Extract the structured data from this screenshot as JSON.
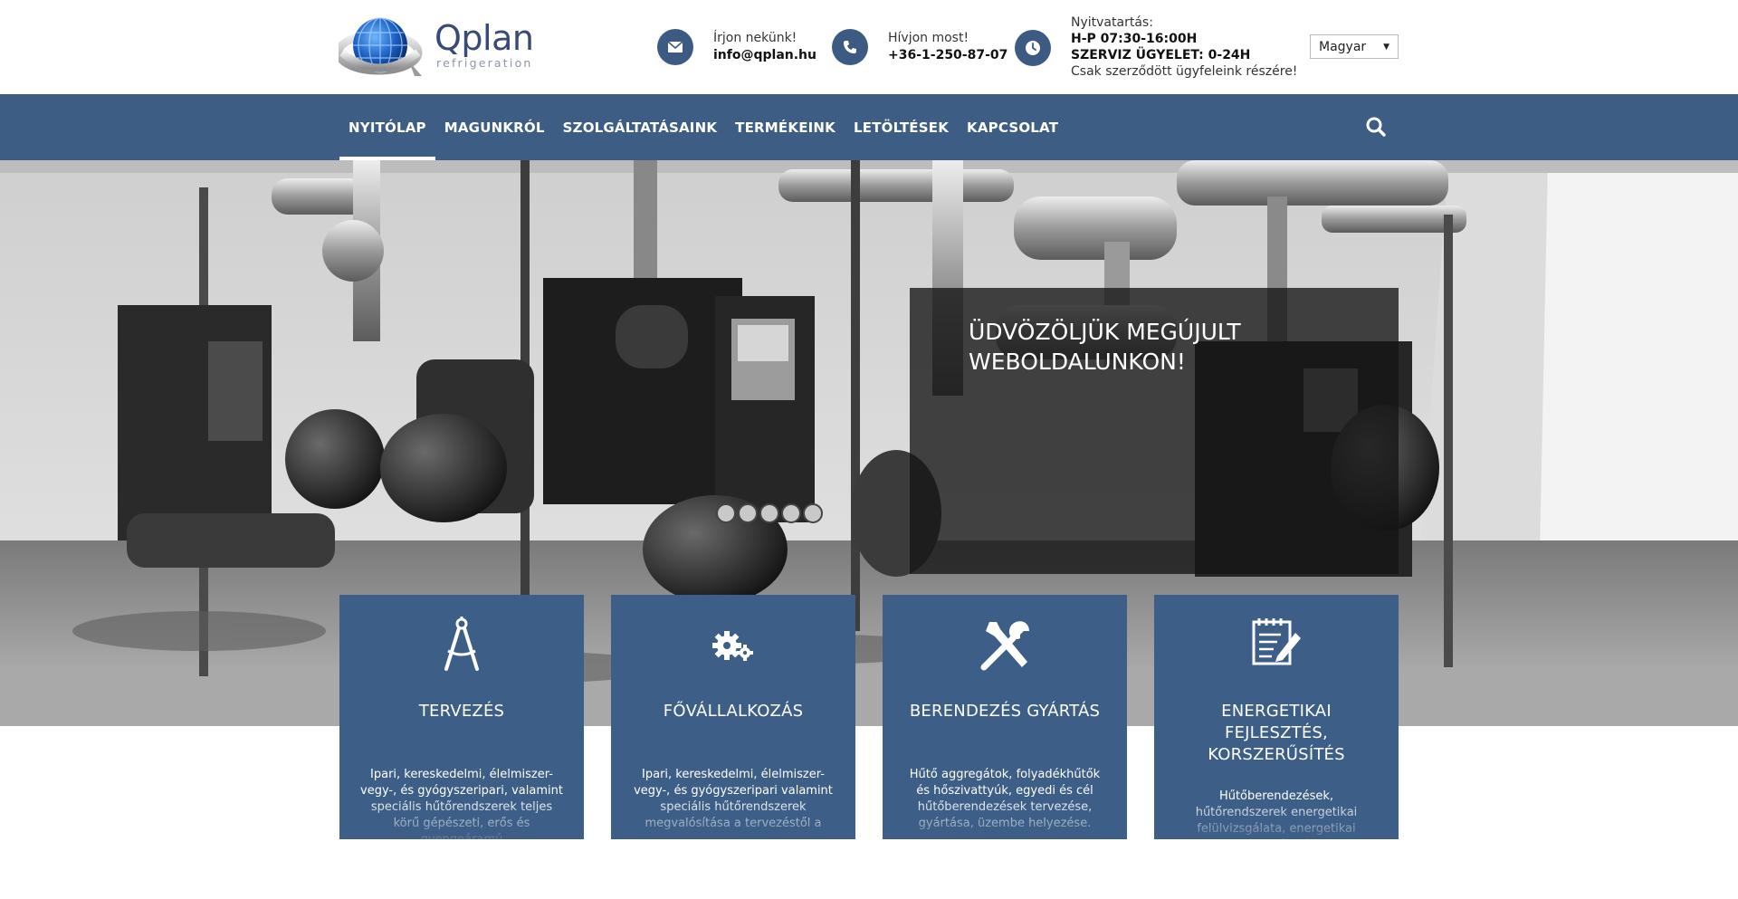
{
  "brand": {
    "name": "Qplan",
    "tagline": "refrigeration",
    "icon": "globe-logo-icon",
    "color": "#3d5d85"
  },
  "contact": {
    "email": {
      "label": "Írjon nekünk!",
      "value": "info@qplan.hu",
      "icon": "envelope-icon"
    },
    "phone": {
      "label": "Hívjon most!",
      "value": "+36-1-250-87-07",
      "icon": "phone-icon"
    },
    "hours": {
      "label": "Nyitvatartás:",
      "line1": "H-P 07:30-16:00H",
      "line2": "SZERVIZ ÜGYELET: 0-24H",
      "note": "Csak szerződött ügyfeleink részére!",
      "icon": "clock-icon"
    }
  },
  "language": {
    "selected": "Magyar"
  },
  "nav": {
    "items": [
      {
        "label": "NYITÓLAP",
        "active": true
      },
      {
        "label": "MAGUNKRÓL"
      },
      {
        "label": "SZOLGÁLTATÁSAINK"
      },
      {
        "label": "TERMÉKEINK"
      },
      {
        "label": "LETÖLTÉSEK"
      },
      {
        "label": "KAPCSOLAT"
      }
    ],
    "search_icon": "search-icon"
  },
  "hero": {
    "title": "ÜDVÖZÖLJÜK MEGÚJULT WEBOLDALUNKON!"
  },
  "services": [
    {
      "title": "TERVEZÉS",
      "icon": "compass-icon",
      "text": "Ipari, kereskedelmi, élelmiszer-vegy-, és gyógyszeripari, valamint speciális hűtőrendszerek teljes körű gépészeti, erős és gyengeáramú"
    },
    {
      "title": "FŐVÁLLALKOZÁS",
      "icon": "gears-icon",
      "text": "Ipari, kereskedelmi, élelmiszer-vegy-, és gyógyszeripari valamint speciális hűtőrendszerek megvalósítása a tervezéstől a"
    },
    {
      "title": "BERENDEZÉS GYÁRTÁS",
      "icon": "tools-icon",
      "text": "Hűtő aggregátok, folyadékhűtők és hőszivattyúk, egyedi és cél hűtőberendezések tervezése, gyártása, üzembe helyezése."
    },
    {
      "title": "ENERGETIKAI FEJLESZTÉS, KORSZERŰSÍTÉS",
      "icon": "notepad-icon",
      "text": "Hűtőberendezések, hűtőrendszerek energetikai felülvizsgálata, energetikai fejlesztése és"
    }
  ]
}
